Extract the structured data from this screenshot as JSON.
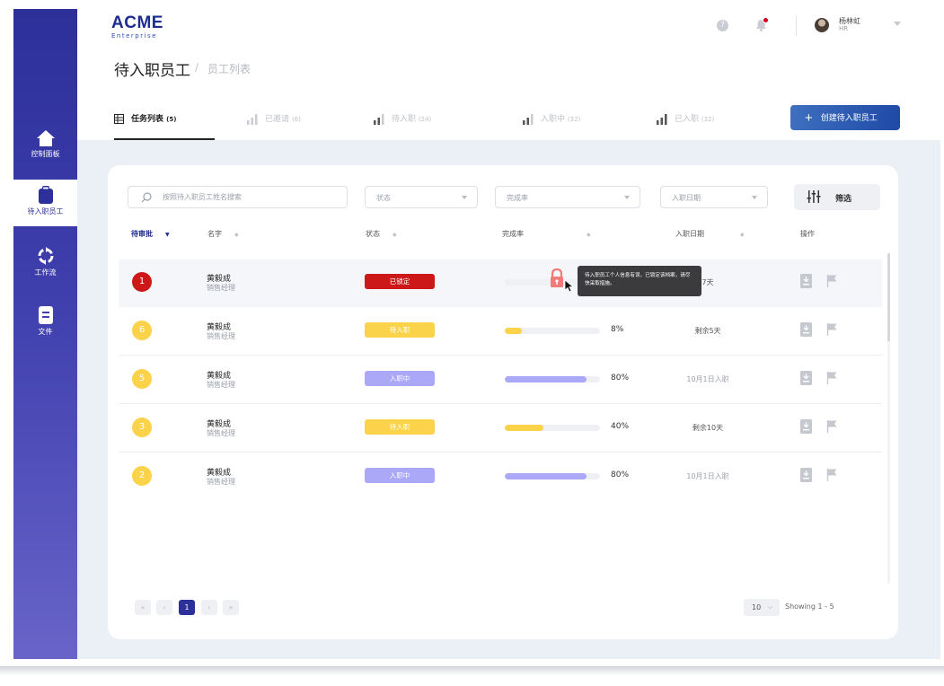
{
  "sidebar": {
    "items": [
      {
        "label": "控制面板",
        "icon": "home-icon"
      },
      {
        "label": "待入职员工",
        "icon": "clipboard-icon"
      },
      {
        "label": "工作流",
        "icon": "workflow-icon"
      },
      {
        "label": "文件",
        "icon": "document-icon"
      }
    ]
  },
  "header": {
    "logo_main": "ACME",
    "logo_sub": "Enterprise",
    "help": "?",
    "user_name": "杨林虹",
    "user_role": "HR"
  },
  "page": {
    "title": "待入职员工",
    "separator": "/",
    "breadcrumb": "员工列表"
  },
  "tabs": [
    {
      "label": "任务列表",
      "count": "(5)"
    },
    {
      "label": "已邀请",
      "count": "(6)"
    },
    {
      "label": "待入职",
      "count": "(24)"
    },
    {
      "label": "入职中",
      "count": "(32)"
    },
    {
      "label": "已入职",
      "count": "(32)"
    }
  ],
  "create_button": {
    "plus": "+",
    "label": "创建待入职员工"
  },
  "filters": {
    "search_placeholder": "按照待入职员工姓名搜索",
    "status": "状态",
    "completion": "完成率",
    "entry_date": "入职日期",
    "filter_button": "筛选"
  },
  "table": {
    "columns": [
      "待审批",
      "名字",
      "状态",
      "完成率",
      "入职日期",
      "操作"
    ],
    "rows": [
      {
        "num": "1",
        "name": "黄毅成",
        "role": "销售经理",
        "status": "已锁定",
        "pct": "",
        "progress": 0,
        "date": "7天"
      },
      {
        "num": "6",
        "name": "黄毅成",
        "role": "销售经理",
        "status": "待入职",
        "pct": "8%",
        "progress": 0.18,
        "date": "剩余5天"
      },
      {
        "num": "5",
        "name": "黄毅成",
        "role": "销售经理",
        "status": "入职中",
        "pct": "80%",
        "progress": 0.86,
        "date": "10月1日入职"
      },
      {
        "num": "3",
        "name": "黄毅成",
        "role": "销售经理",
        "status": "待入职",
        "pct": "40%",
        "progress": 0.41,
        "date": "剩余10天"
      },
      {
        "num": "2",
        "name": "黄毅成",
        "role": "销售经理",
        "status": "入职中",
        "pct": "80%",
        "progress": 0.86,
        "date": "10月1日入职"
      }
    ]
  },
  "tooltip": {
    "text": "待入职员工个人信息有误，已锁定该档案，请尽快采取措施。"
  },
  "pagination": {
    "first": "«",
    "prev": "‹",
    "current": "1",
    "next": "›",
    "last": "»",
    "page_size": "10",
    "showing": "Showing 1 - 5"
  },
  "colors": {
    "primary": "#2d2f9a",
    "locked": "#cc1818",
    "pending": "#fbd34a",
    "onboarding": "#aaa8f7"
  }
}
